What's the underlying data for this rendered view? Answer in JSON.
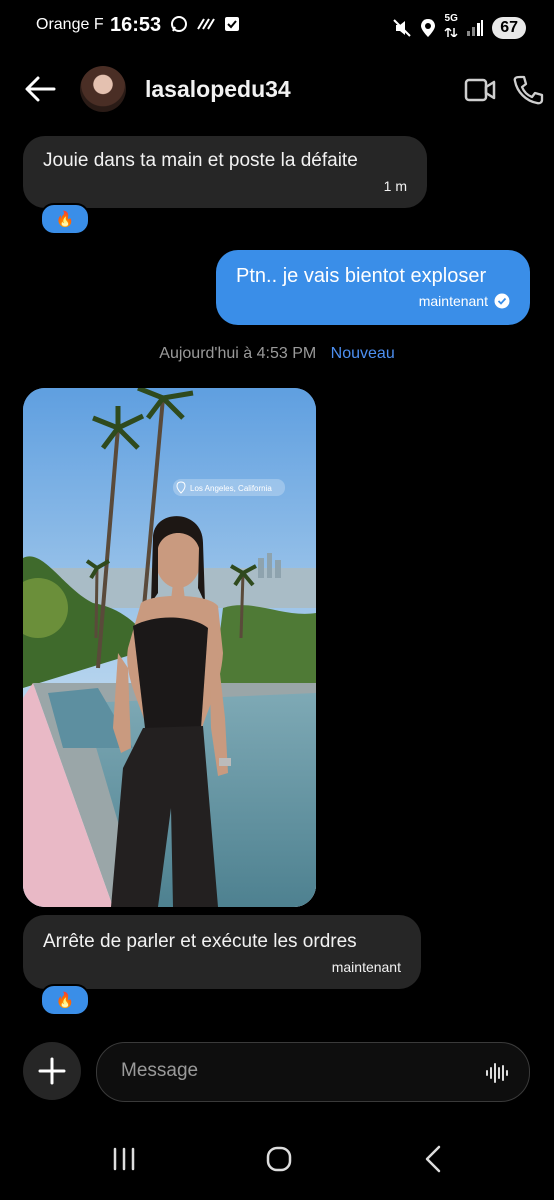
{
  "status_bar": {
    "carrier": "Orange F",
    "time": "16:53",
    "network": "5G",
    "battery": "67"
  },
  "header": {
    "contact_name": "lasalopedu34"
  },
  "messages": [
    {
      "direction": "incoming",
      "text": "Jouie dans ta main et poste la défaite",
      "time": "1 m",
      "reaction": "🔥"
    },
    {
      "direction": "outgoing",
      "text": "Ptn.. je vais bientot exploser",
      "time": "maintenant",
      "status": "seen"
    }
  ],
  "date_separator": {
    "date": "Aujourd'hui à 4:53 PM",
    "new_label": "Nouveau"
  },
  "photo_message": {
    "location_label": "Los Angeles, California"
  },
  "last_message": {
    "direction": "incoming",
    "text": "Arrête de parler et exécute les ordres",
    "time": "maintenant",
    "reaction": "🔥"
  },
  "composer": {
    "placeholder": "Message"
  },
  "colors": {
    "accent": "#3a8ee8",
    "incoming_bubble": "#262626",
    "background": "#000000",
    "new_label": "#4d8ff0"
  }
}
